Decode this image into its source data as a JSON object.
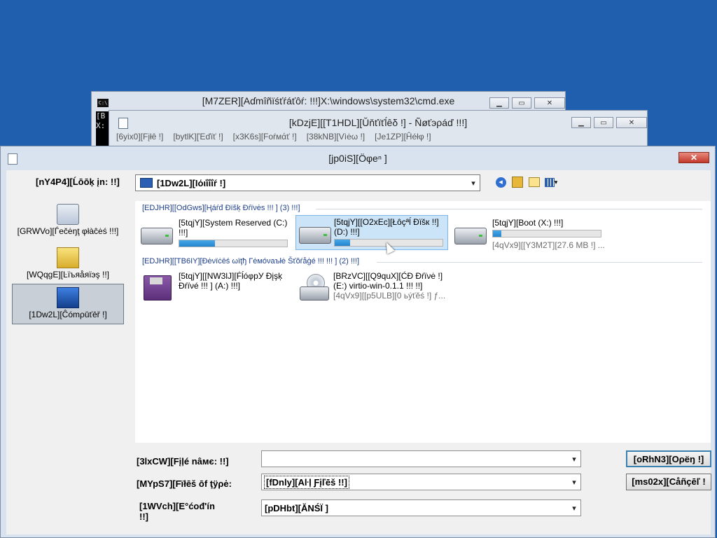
{
  "cmd_window": {
    "title": "[M7ZER][Aɗmîñïśťŕáťôŕ:  !!!]X:\\windows\\system32\\cmd.exe",
    "icon_text": "C:\\",
    "body_text": "[B\nX:"
  },
  "notepad_window": {
    "title": "[kDzjE][[T1HDL][Ŭňťïťĺêδ !] - Ñøťэρáď !!!]",
    "menu": [
      "[6yix0][Fįłê !]",
      "[bytlK][Έďïť !]",
      "[x3K6s][Foŕмάť !]",
      "[38kNB][Vìėω !]",
      "[Je1ZP][Ĥéłφ !]"
    ]
  },
  "dialog": {
    "title": "[jp0iS][Öφeⁿ ]",
    "look_in_label": "[nY4P4][Ĺōōķ įn: !!]",
    "look_in_value": "[1Dw2L][Ιόιΐΐΐŕ !]",
    "places": [
      {
        "label": "[GRWVo][Ѓеčėŋţ φłàĉėś !!!]",
        "icon": "recent-places-icon",
        "selected": false
      },
      {
        "label": "[WQqgE][Ŀïъяåяïэş !!]",
        "icon": "libraries-icon",
        "selected": false
      },
      {
        "label": "[1Dw2L][Ĉómρūťēř !]",
        "icon": "computer-icon",
        "selected": true
      }
    ],
    "groups": [
      {
        "header": "[EDJHR][[OdGws][Ңáŕđ Ðïšķ Ðŕïνės !!! ] (3) !!!]"
      },
      {
        "header": "[EDJHR][[TB6IY][Ðėνїċēś ωïţђ Гėмóνаъłė Šťŏŕåģé !!! !!! ] (2) !!!]"
      }
    ],
    "drives": [
      {
        "name": "[5tqjY][System Reserved (C:) !!!]",
        "usage": 0.33,
        "selected": false,
        "icon": "hard-drive-icon"
      },
      {
        "name": "[5tqjY][[O2xEc][Łôçªĺ Ðïšк !!] (D:) !!!]",
        "usage": 0.14,
        "selected": true,
        "icon": "hard-drive-icon"
      },
      {
        "name": "[5tqjY][Boot (X:) !!!]",
        "usage": 0.08,
        "sub": "[4qVx9][[Y3M2T][27.6 MB !] ...",
        "selected": false,
        "icon": "hard-drive-icon"
      },
      {
        "name": "[5tqjY][[NW3lJ][ḞĺóφpУ Ðįşķ Ðŕïνé !!! ] (A:) !!!]",
        "selected": false,
        "icon": "floppy-drive-icon"
      },
      {
        "name": "[BRzVC][[Q9quX][ĆÐ Ðŕïνė !] (E:) virtio-win-0.1.1 !!! !!]",
        "sub": "[4qVx9][[p5ULB][0 ьýťĕś !] ƒ...",
        "selected": false,
        "icon": "cd-drive-icon"
      }
    ],
    "file_name_label": "[3lxCW][Fįļé nâмє: !!]",
    "file_name_value": "",
    "files_type_label": "[MYpS7][Fїłēš ōf ţÿρė:",
    "files_type_value": "[fDnly][Aŀļ Ƒįľēš  !!]",
    "encoding_label": "[1WVch][Ε°ćođ'ín !!]",
    "encoding_value": "[pDHbt][ĂΝŚΪ ]",
    "open_button": "[oRhN3][Oρёŋ !]",
    "cancel_button": "[ms02x][Cåñçēľ !"
  }
}
